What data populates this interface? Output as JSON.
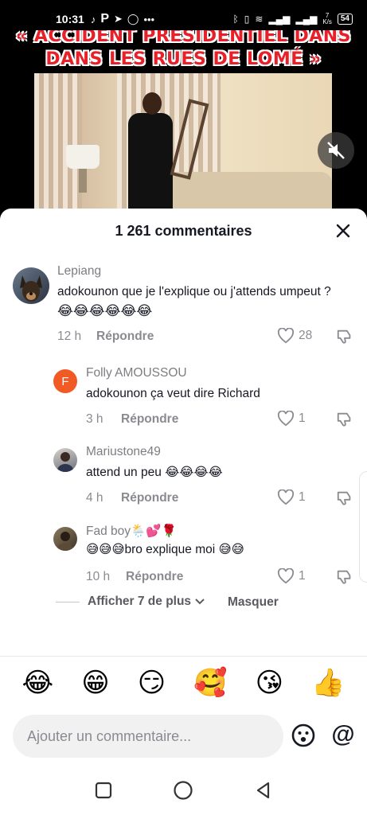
{
  "status_bar": {
    "time": "10:31",
    "speed_value": "7",
    "speed_unit": "K/s",
    "battery": "54"
  },
  "video": {
    "caption_line1": "« ACCIDENT PRÉSIDENTIEL DANS",
    "caption_line2": "DANS LES RUES DE LOMÉ »"
  },
  "sheet": {
    "title": "1 261 commentaires"
  },
  "comments": [
    {
      "username": "Lepiang",
      "text": "adokounon que je l'explique ou j'attends umpeut ?",
      "emojis": "😂😂😂😂😂😂",
      "time": "12 h",
      "reply_label": "Répondre",
      "likes": "28"
    },
    {
      "username": "Folly AMOUSSOU",
      "avatar_letter": "F",
      "avatar_color": "#f15a24",
      "text": "adokounon ça veut dire Richard",
      "time": "3 h",
      "reply_label": "Répondre",
      "likes": "1"
    },
    {
      "username": "Mariustone49",
      "text": "attend un peu 😂😂😂😂",
      "time": "4 h",
      "reply_label": "Répondre",
      "likes": "1"
    },
    {
      "username": "Fad boy🌦️💕🌹",
      "text": "😅😅😅bro explique moi 😅😅",
      "time": "10 h",
      "reply_label": "Répondre",
      "likes": "1"
    }
  ],
  "more_replies": {
    "show_more_label": "Afficher 7 de plus",
    "hide_label": "Masquer"
  },
  "quick_emojis": [
    "😂",
    "😁",
    "😏",
    "🥰",
    "😘",
    "👍"
  ],
  "composer": {
    "placeholder": "Ajouter un commentaire...",
    "at_symbol": "@"
  },
  "colors": {
    "text_primary": "#161823",
    "text_secondary": "#8a8b91",
    "caption_red": "#e8202a"
  }
}
